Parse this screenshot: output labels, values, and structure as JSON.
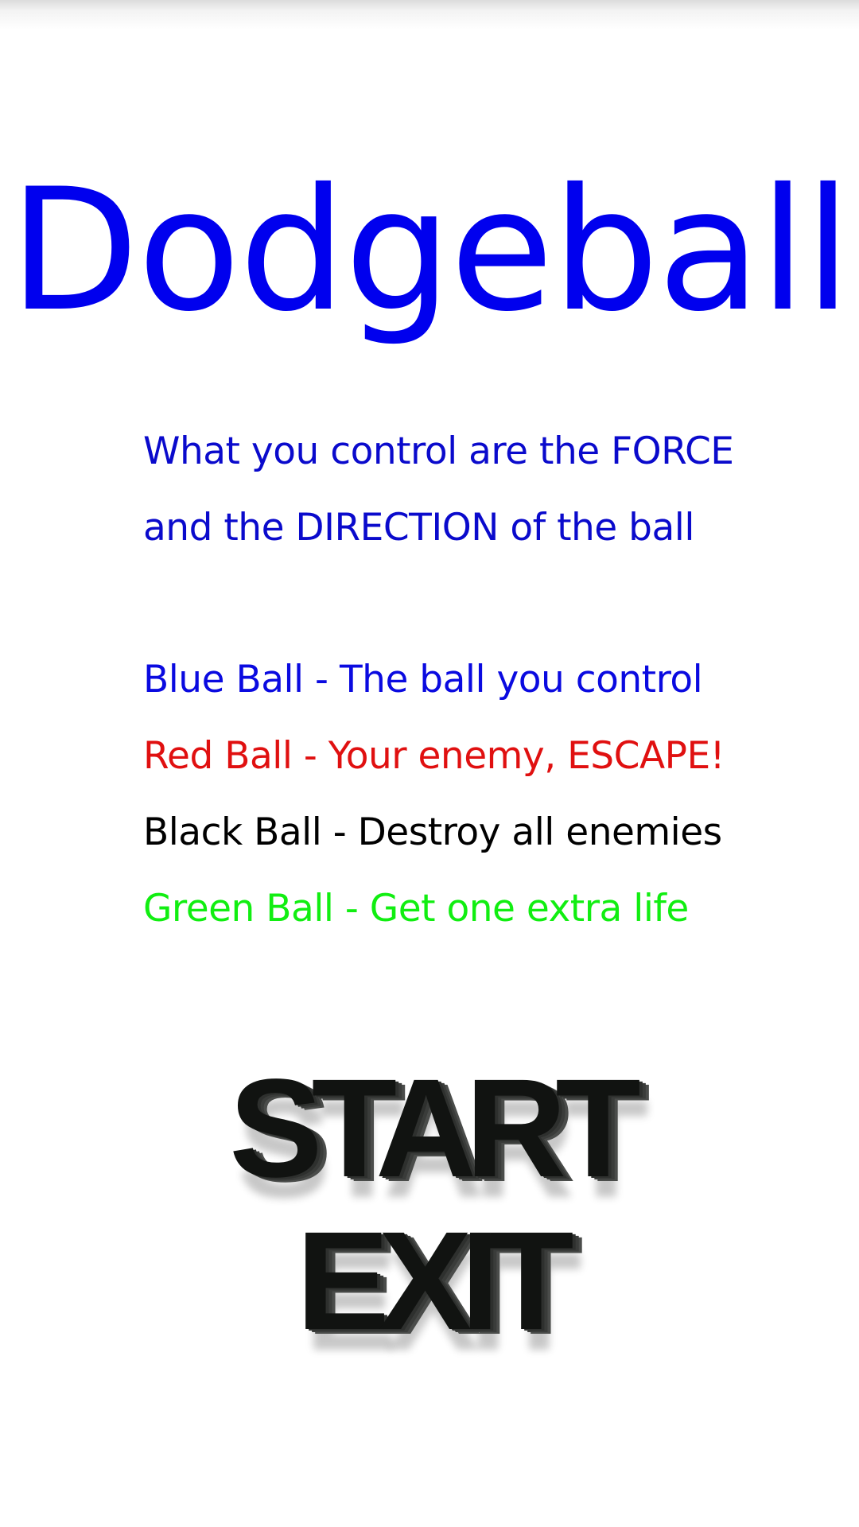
{
  "title": {
    "text": "Dodgeball",
    "color": "#0000ee"
  },
  "intro": [
    {
      "text": "What you control are the FORCE",
      "color": "#0a0acc"
    },
    {
      "text": "and the DIRECTION of the ball",
      "color": "#0a0acc"
    }
  ],
  "legend": [
    {
      "text": "Blue Ball - The ball you control",
      "color": "#0a0ae0"
    },
    {
      "text": "Red Ball - Your enemy, ESCAPE!",
      "color": "#e01010"
    },
    {
      "text": "Black Ball - Destroy all enemies",
      "color": "#000000"
    },
    {
      "text": "Green Ball - Get one extra life",
      "color": "#11ee11"
    }
  ],
  "menu": {
    "start_label": "START",
    "exit_label": "EXIT"
  }
}
